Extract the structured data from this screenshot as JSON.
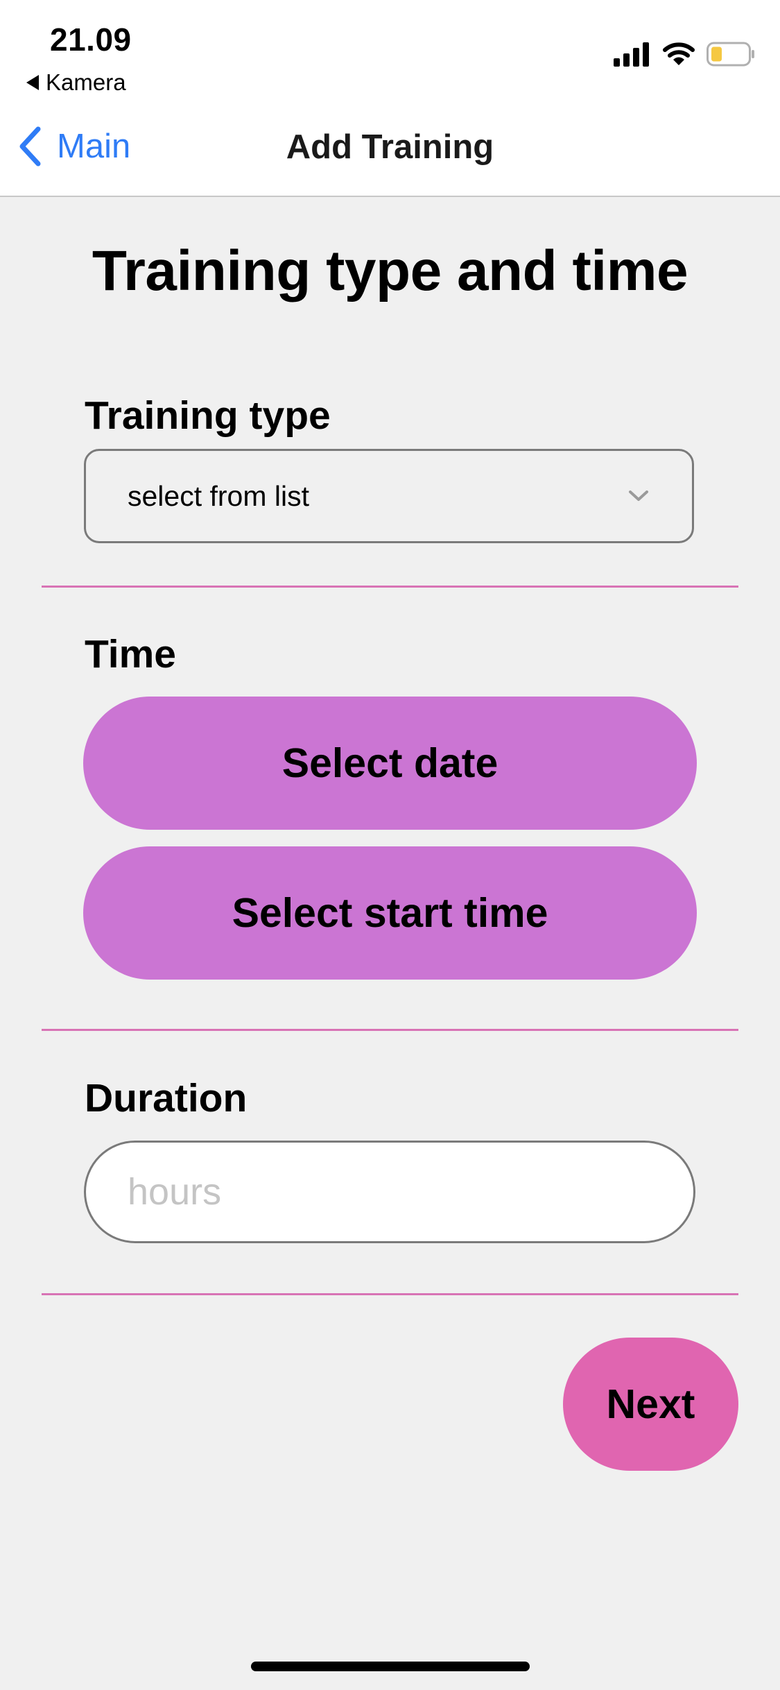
{
  "status_bar": {
    "time": "21.09",
    "back_app_label": "Kamera",
    "battery_color": "#f5c842"
  },
  "nav_bar": {
    "back_label": "Main",
    "title": "Add Training",
    "accent_color": "#2f7cf6"
  },
  "page": {
    "title": "Training type and time"
  },
  "training_type": {
    "label": "Training type",
    "selected_value": "select from list"
  },
  "time": {
    "label": "Time",
    "select_date_label": "Select date",
    "select_start_time_label": "Select start time",
    "button_color": "#cb75d3"
  },
  "duration": {
    "label": "Duration",
    "value": "",
    "placeholder": "hours"
  },
  "next": {
    "label": "Next",
    "color": "#e065b0"
  },
  "divider_color": "#d873b5"
}
